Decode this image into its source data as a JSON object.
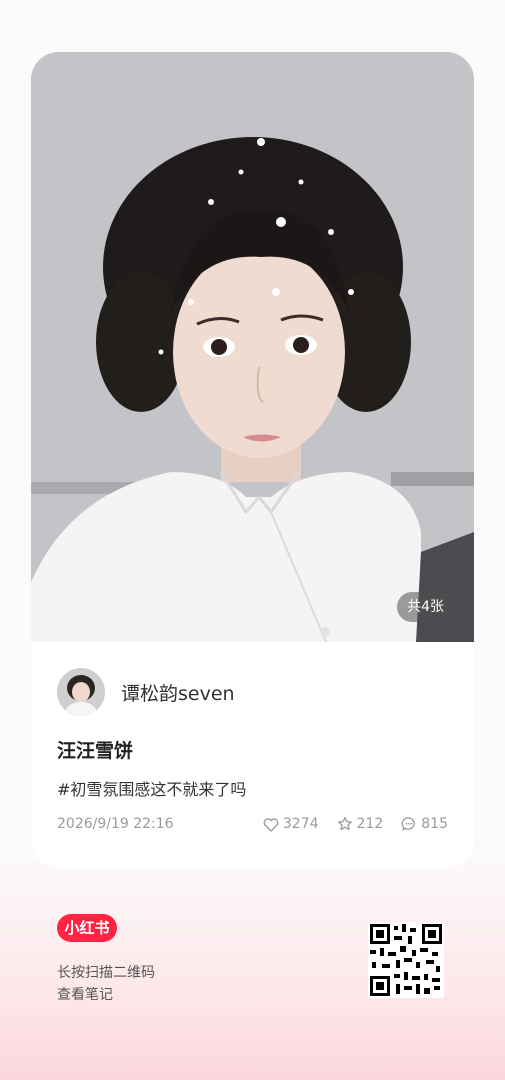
{
  "note": {
    "image_count_badge": "共4张",
    "author_name": "谭松韵seven",
    "title": "汪汪雪饼",
    "tag_text": "#初雪氛围感这不就来了吗",
    "date": "2026/9/19 22:16",
    "likes": "3274",
    "collects": "212",
    "comments": "815"
  },
  "footer": {
    "brand": "小红书",
    "hint_line1": "长按扫描二维码",
    "hint_line2": "查看笔记"
  },
  "colors": {
    "brand_red": "#ff2442",
    "meta_gray": "#9a9a9a"
  },
  "icons": {
    "like": "heart-icon",
    "collect": "star-icon",
    "comment": "comment-icon"
  }
}
